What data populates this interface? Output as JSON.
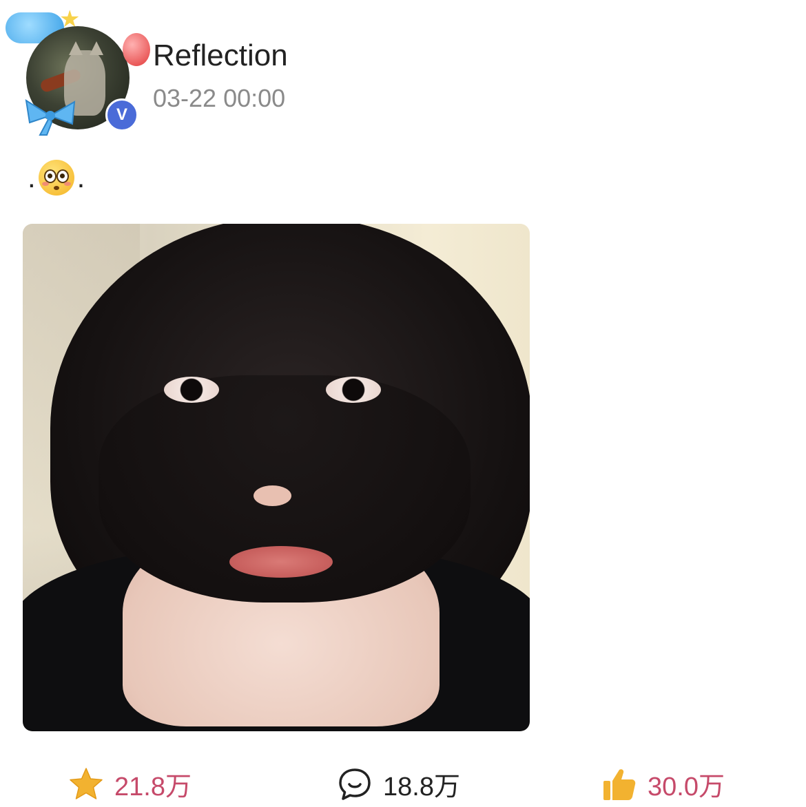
{
  "post": {
    "author": {
      "username": "Reflection",
      "timestamp": "03-22 00:00",
      "verified_badge": "V"
    },
    "caption": {
      "prefix": ".",
      "emoji": "flushed-face",
      "suffix": "."
    },
    "photo": {
      "subject": "selfie-portrait"
    },
    "actions": {
      "favorite": {
        "icon": "star-icon",
        "count": "21.8万",
        "color": "#c64a6a"
      },
      "comment": {
        "icon": "comment-bubble-icon",
        "count": "18.8万",
        "color": "#222222"
      },
      "like": {
        "icon": "thumbs-up-icon",
        "count": "30.0万",
        "color": "#c64a6a"
      }
    }
  },
  "colors": {
    "accent_pink": "#c64a6a",
    "icon_gold": "#f2b230",
    "verified_blue": "#4a6bd8"
  }
}
